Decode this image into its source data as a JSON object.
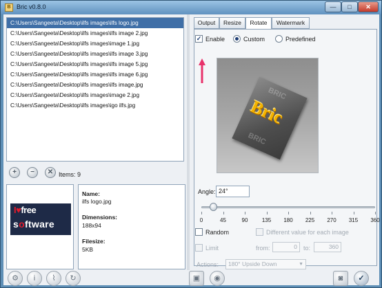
{
  "window": {
    "title": "Bric v0.8.0",
    "minimize_glyph": "—",
    "maximize_glyph": "□",
    "close_glyph": "✕"
  },
  "files": [
    "C:\\Users\\Sangeeta\\Desktop\\ilfs images\\ilfs logo.jpg",
    "C:\\Users\\Sangeeta\\Desktop\\ilfs images\\ilfs image 2.jpg",
    "C:\\Users\\Sangeeta\\Desktop\\ilfs images\\image 1.jpg",
    "C:\\Users\\Sangeeta\\Desktop\\ilfs images\\ilfs image 3.jpg",
    "C:\\Users\\Sangeeta\\Desktop\\ilfs images\\ilfs image 5.jpg",
    "C:\\Users\\Sangeeta\\Desktop\\ilfs images\\ilfs image 6.jpg",
    "C:\\Users\\Sangeeta\\Desktop\\ilfs images\\ilfs image.jpg",
    "C:\\Users\\Sangeeta\\Desktop\\ilfs images\\image 2.jpg",
    "C:\\Users\\Sangeeta\\Desktop\\ilfs images\\igo ilfs.jpg"
  ],
  "list_actions": {
    "add_glyph": "+",
    "remove_glyph": "−",
    "clear_glyph": "✕",
    "items_label": "Items: 9"
  },
  "preview_logo": {
    "line1_i": "I",
    "line1_heart": "♥",
    "line1_free": "free",
    "line2_pre": "s",
    "line2_o": "o",
    "line2_post": "ftware"
  },
  "info": {
    "name_label": "Name:",
    "name_value": "ilfs logo.jpg",
    "dimensions_label": "Dimensions:",
    "dimensions_value": "188x94",
    "filesize_label": "Filesize:",
    "filesize_value": "5KB"
  },
  "tabs": [
    "Output",
    "Resize",
    "Rotate",
    "Watermark"
  ],
  "active_tab": "Rotate",
  "rotate": {
    "enable_label": "Enable",
    "enable_checked": true,
    "custom_label": "Custom",
    "predefined_label": "Predefined",
    "preview_watermark_top": "BRIC",
    "preview_watermark_bottom": "BRIC",
    "preview_center_text": "Bric",
    "angle_label": "Angle:",
    "angle_value": "24°",
    "slider_value_degrees": 24,
    "slider_range": [
      0,
      360
    ],
    "slider_ticks": [
      "0",
      "45",
      "90",
      "135",
      "180",
      "225",
      "270",
      "315",
      "360"
    ],
    "random_label": "Random",
    "different_value_label": "Different value for each image",
    "limit_label": "Limit",
    "from_label": "from:",
    "from_value": "0",
    "to_label": "to:",
    "to_value": "360",
    "actions_label": "Actions:",
    "actions_value": "180° Upside Down"
  },
  "bottom_icons": [
    "gear-icon",
    "info-icon",
    "attach-icon",
    "refresh-icon",
    "save-icon",
    "disc-icon",
    "camera-icon",
    "ok-icon"
  ],
  "colors": {
    "accent": "#3f6fa7",
    "window_frame": "#5e8fb6",
    "arrow": "#e8336b"
  }
}
